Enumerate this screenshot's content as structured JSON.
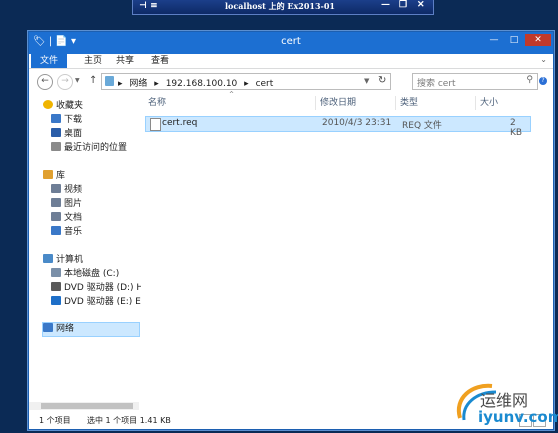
{
  "rdp": {
    "title": "localhost 上的 Ex2013-01",
    "pin": "⊣ ≡",
    "controls": [
      "—",
      "❐",
      "✕"
    ]
  },
  "window": {
    "title": "cert",
    "min": "—",
    "max": "□",
    "close": "✕",
    "qa": "🏷 | 📄 ▾"
  },
  "ribbon": {
    "tabs": [
      "文件",
      "主页",
      "共享",
      "查看"
    ],
    "toggle": "⌄",
    "help": "?"
  },
  "nav": {
    "back": "←",
    "fwd": "→",
    "drop": "▼",
    "up": "↑"
  },
  "address": {
    "crumbs": [
      "▸",
      "网络",
      "▸",
      "192.168.100.10",
      "▸",
      "cert"
    ],
    "dropdown": "▼",
    "refresh": "↻"
  },
  "search": {
    "placeholder": "搜索 cert",
    "icon": "⚲"
  },
  "navpane": {
    "items": [
      {
        "label": "收藏夹",
        "color": "#f0b400"
      },
      {
        "label": "下载",
        "color": "#3a78c8"
      },
      {
        "label": "桌面",
        "color": "#2a5da8"
      },
      {
        "label": "最近访问的位置",
        "color": "#8a8a8a"
      },
      {
        "label": "库",
        "color": "#e0a030"
      },
      {
        "label": "视频",
        "color": "#6e7e96"
      },
      {
        "label": "图片",
        "color": "#6e7e96"
      },
      {
        "label": "文档",
        "color": "#6e7e96"
      },
      {
        "label": "音乐",
        "color": "#3a78c8"
      },
      {
        "label": "计算机",
        "color": "#4a8ac8"
      },
      {
        "label": "本地磁盘 (C:)",
        "color": "#7a8fa8"
      },
      {
        "label": "DVD 驱动器 (D:) HI",
        "color": "#5a5a5a"
      },
      {
        "label": "DVD 驱动器 (E:) EX",
        "color": "#1e6fc8"
      },
      {
        "label": "网络",
        "color": "#3a78c8"
      }
    ]
  },
  "table": {
    "headers": [
      "名称",
      "修改日期",
      "类型",
      "大小"
    ],
    "sort_arrow": "^",
    "rows": [
      {
        "name": "cert.req",
        "date": "2010/4/3 23:31",
        "type": "REQ 文件",
        "size": "2 KB"
      }
    ]
  },
  "status": {
    "count": "1 个项目",
    "selected": "选中 1 个项目  1.41 KB"
  },
  "watermark": {
    "brand": "运维网",
    "url": "iyunv.com"
  }
}
